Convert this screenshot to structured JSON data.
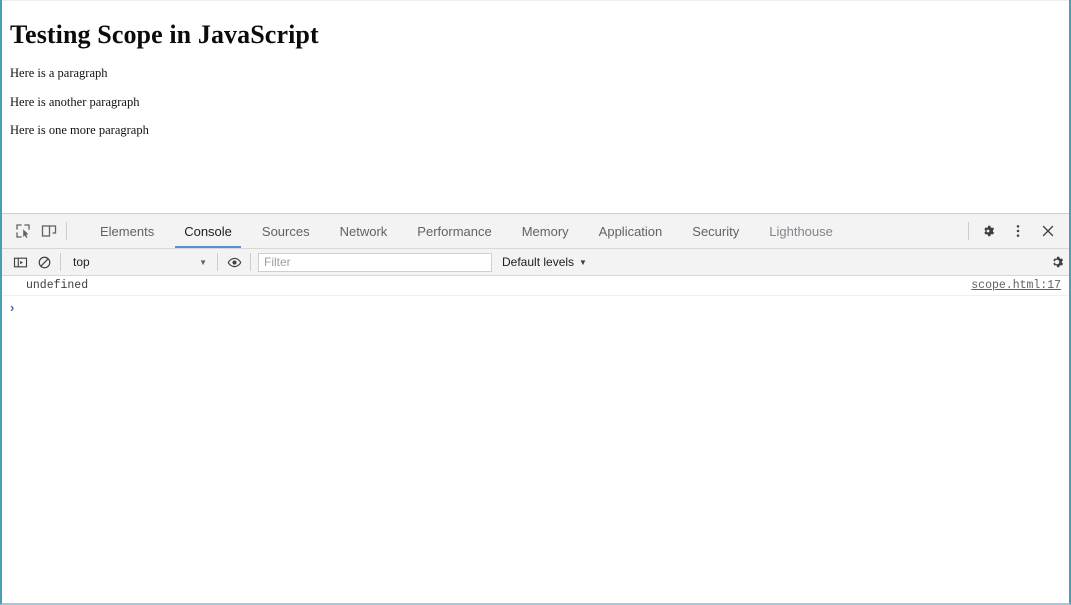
{
  "webpage": {
    "title": "Testing Scope in JavaScript",
    "paragraphs": [
      "Here is a paragraph",
      "Here is another paragraph",
      "Here is one more paragraph"
    ]
  },
  "devtools": {
    "left_icons": [
      {
        "name": "inspect-element-icon",
        "glyph": "inspect"
      },
      {
        "name": "device-toolbar-icon",
        "glyph": "device"
      }
    ],
    "tabs": [
      {
        "label": "Elements",
        "active": false
      },
      {
        "label": "Console",
        "active": true
      },
      {
        "label": "Sources",
        "active": false
      },
      {
        "label": "Network",
        "active": false
      },
      {
        "label": "Performance",
        "active": false
      },
      {
        "label": "Memory",
        "active": false
      },
      {
        "label": "Application",
        "active": false
      },
      {
        "label": "Security",
        "active": false
      },
      {
        "label": "Lighthouse",
        "active": false
      }
    ],
    "right_icons": [
      {
        "name": "settings-gear-icon"
      },
      {
        "name": "more-options-icon"
      },
      {
        "name": "close-devtools-icon"
      }
    ],
    "active_tab_underline_color": "#5b8dd2",
    "toolbar": {
      "sidebar_toggle_icon": "console-sidebar-icon",
      "clear_console_icon": "clear-console-icon",
      "context_value": "top",
      "context_caret": "▼",
      "live_expressions_icon": "eye-icon",
      "filter_placeholder": "Filter",
      "filter_value": "",
      "levels_label": "Default levels",
      "levels_caret": "▼",
      "settings_icon": "console-settings-gear-icon"
    },
    "console": {
      "messages": [
        {
          "text": "undefined",
          "source": "scope.html:17"
        }
      ],
      "prompt_caret": "›",
      "prompt_value": ""
    }
  },
  "colors": {
    "frame_border": "#4e9cb0",
    "toolbar_background": "#f3f3f3",
    "accent_blue": "#5b8dd2",
    "prompt_blue": "#4a6fb5"
  }
}
